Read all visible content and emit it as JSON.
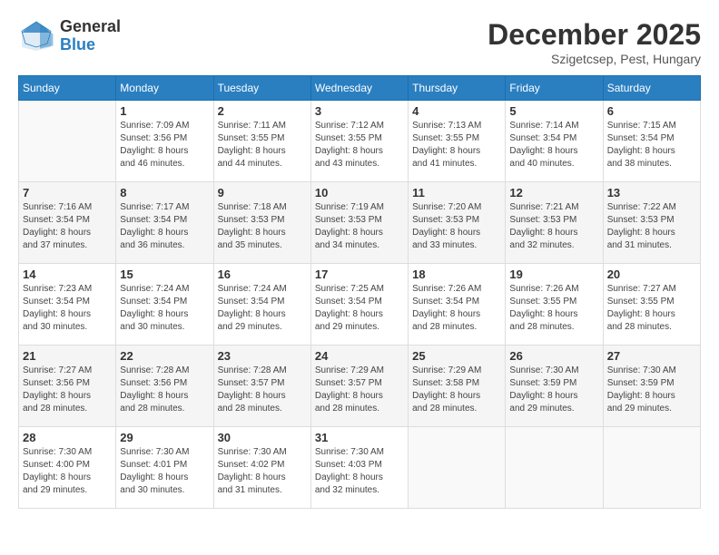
{
  "logo": {
    "general": "General",
    "blue": "Blue"
  },
  "header": {
    "month": "December 2025",
    "location": "Szigetcsep, Pest, Hungary"
  },
  "weekdays": [
    "Sunday",
    "Monday",
    "Tuesday",
    "Wednesday",
    "Thursday",
    "Friday",
    "Saturday"
  ],
  "weeks": [
    [
      {
        "day": "",
        "info": ""
      },
      {
        "day": "1",
        "info": "Sunrise: 7:09 AM\nSunset: 3:56 PM\nDaylight: 8 hours\nand 46 minutes."
      },
      {
        "day": "2",
        "info": "Sunrise: 7:11 AM\nSunset: 3:55 PM\nDaylight: 8 hours\nand 44 minutes."
      },
      {
        "day": "3",
        "info": "Sunrise: 7:12 AM\nSunset: 3:55 PM\nDaylight: 8 hours\nand 43 minutes."
      },
      {
        "day": "4",
        "info": "Sunrise: 7:13 AM\nSunset: 3:55 PM\nDaylight: 8 hours\nand 41 minutes."
      },
      {
        "day": "5",
        "info": "Sunrise: 7:14 AM\nSunset: 3:54 PM\nDaylight: 8 hours\nand 40 minutes."
      },
      {
        "day": "6",
        "info": "Sunrise: 7:15 AM\nSunset: 3:54 PM\nDaylight: 8 hours\nand 38 minutes."
      }
    ],
    [
      {
        "day": "7",
        "info": "Sunrise: 7:16 AM\nSunset: 3:54 PM\nDaylight: 8 hours\nand 37 minutes."
      },
      {
        "day": "8",
        "info": "Sunrise: 7:17 AM\nSunset: 3:54 PM\nDaylight: 8 hours\nand 36 minutes."
      },
      {
        "day": "9",
        "info": "Sunrise: 7:18 AM\nSunset: 3:53 PM\nDaylight: 8 hours\nand 35 minutes."
      },
      {
        "day": "10",
        "info": "Sunrise: 7:19 AM\nSunset: 3:53 PM\nDaylight: 8 hours\nand 34 minutes."
      },
      {
        "day": "11",
        "info": "Sunrise: 7:20 AM\nSunset: 3:53 PM\nDaylight: 8 hours\nand 33 minutes."
      },
      {
        "day": "12",
        "info": "Sunrise: 7:21 AM\nSunset: 3:53 PM\nDaylight: 8 hours\nand 32 minutes."
      },
      {
        "day": "13",
        "info": "Sunrise: 7:22 AM\nSunset: 3:53 PM\nDaylight: 8 hours\nand 31 minutes."
      }
    ],
    [
      {
        "day": "14",
        "info": "Sunrise: 7:23 AM\nSunset: 3:54 PM\nDaylight: 8 hours\nand 30 minutes."
      },
      {
        "day": "15",
        "info": "Sunrise: 7:24 AM\nSunset: 3:54 PM\nDaylight: 8 hours\nand 30 minutes."
      },
      {
        "day": "16",
        "info": "Sunrise: 7:24 AM\nSunset: 3:54 PM\nDaylight: 8 hours\nand 29 minutes."
      },
      {
        "day": "17",
        "info": "Sunrise: 7:25 AM\nSunset: 3:54 PM\nDaylight: 8 hours\nand 29 minutes."
      },
      {
        "day": "18",
        "info": "Sunrise: 7:26 AM\nSunset: 3:54 PM\nDaylight: 8 hours\nand 28 minutes."
      },
      {
        "day": "19",
        "info": "Sunrise: 7:26 AM\nSunset: 3:55 PM\nDaylight: 8 hours\nand 28 minutes."
      },
      {
        "day": "20",
        "info": "Sunrise: 7:27 AM\nSunset: 3:55 PM\nDaylight: 8 hours\nand 28 minutes."
      }
    ],
    [
      {
        "day": "21",
        "info": "Sunrise: 7:27 AM\nSunset: 3:56 PM\nDaylight: 8 hours\nand 28 minutes."
      },
      {
        "day": "22",
        "info": "Sunrise: 7:28 AM\nSunset: 3:56 PM\nDaylight: 8 hours\nand 28 minutes."
      },
      {
        "day": "23",
        "info": "Sunrise: 7:28 AM\nSunset: 3:57 PM\nDaylight: 8 hours\nand 28 minutes."
      },
      {
        "day": "24",
        "info": "Sunrise: 7:29 AM\nSunset: 3:57 PM\nDaylight: 8 hours\nand 28 minutes."
      },
      {
        "day": "25",
        "info": "Sunrise: 7:29 AM\nSunset: 3:58 PM\nDaylight: 8 hours\nand 28 minutes."
      },
      {
        "day": "26",
        "info": "Sunrise: 7:30 AM\nSunset: 3:59 PM\nDaylight: 8 hours\nand 29 minutes."
      },
      {
        "day": "27",
        "info": "Sunrise: 7:30 AM\nSunset: 3:59 PM\nDaylight: 8 hours\nand 29 minutes."
      }
    ],
    [
      {
        "day": "28",
        "info": "Sunrise: 7:30 AM\nSunset: 4:00 PM\nDaylight: 8 hours\nand 29 minutes."
      },
      {
        "day": "29",
        "info": "Sunrise: 7:30 AM\nSunset: 4:01 PM\nDaylight: 8 hours\nand 30 minutes."
      },
      {
        "day": "30",
        "info": "Sunrise: 7:30 AM\nSunset: 4:02 PM\nDaylight: 8 hours\nand 31 minutes."
      },
      {
        "day": "31",
        "info": "Sunrise: 7:30 AM\nSunset: 4:03 PM\nDaylight: 8 hours\nand 32 minutes."
      },
      {
        "day": "",
        "info": ""
      },
      {
        "day": "",
        "info": ""
      },
      {
        "day": "",
        "info": ""
      }
    ]
  ]
}
